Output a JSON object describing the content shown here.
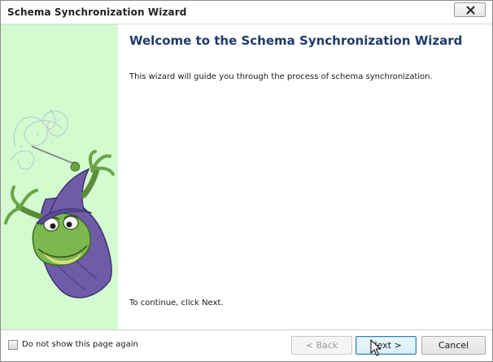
{
  "window": {
    "title": "Schema Synchronization Wizard",
    "close_icon": "close-x-icon"
  },
  "side_panel": {
    "background_color": "#d4fad0",
    "illustration": "wizard-frog-illustration"
  },
  "content": {
    "heading": "Welcome to the Schema Synchronization Wizard",
    "intro": "This wizard will guide you through the process of schema synchronization.",
    "continue_hint": "To continue, click Next."
  },
  "footer": {
    "checkbox_label": "Do not show this page again",
    "checkbox_checked": false,
    "back_label": "< Back",
    "back_enabled": false,
    "next_label": "Next >",
    "cancel_label": "Cancel"
  },
  "colors": {
    "heading": "#1d3b6a",
    "next_button_border": "#3c7fb1"
  }
}
